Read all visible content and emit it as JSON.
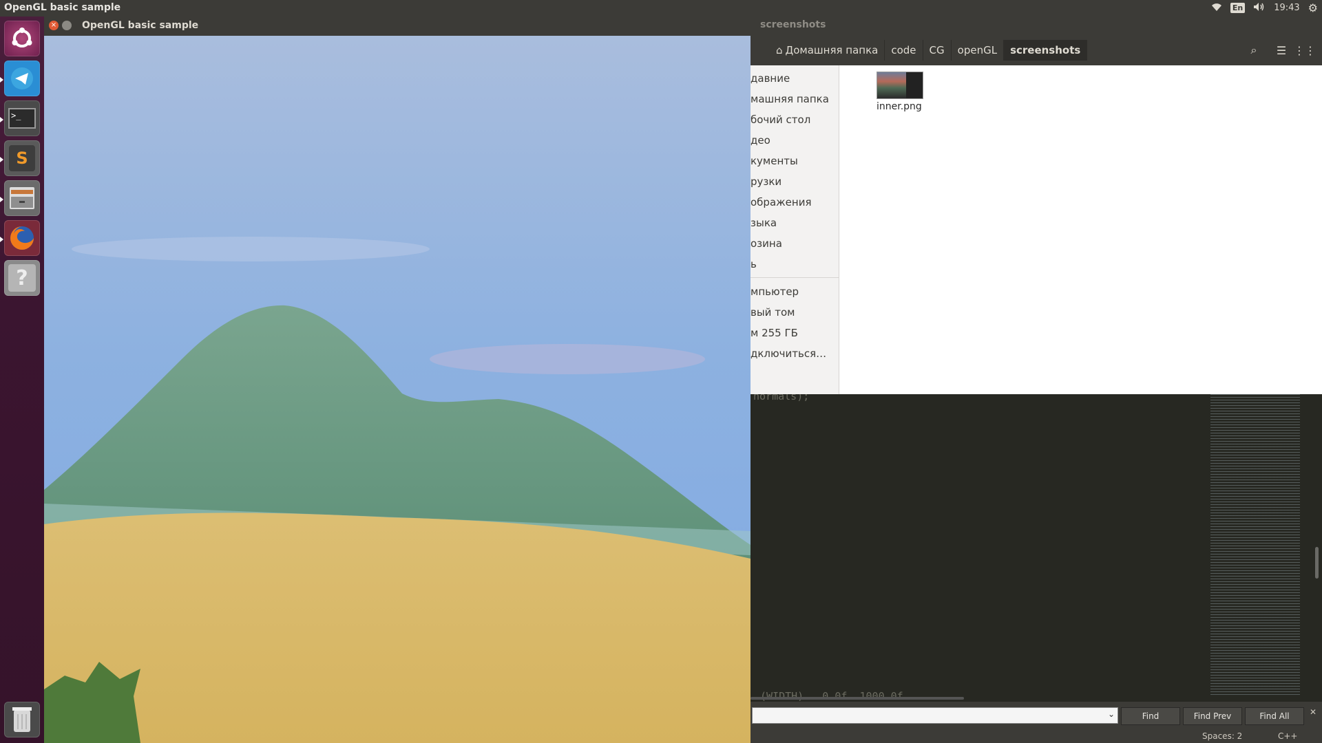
{
  "topbar": {
    "title": "OpenGL basic sample",
    "keyboard": "En",
    "time": "19:43"
  },
  "launcher": {
    "items": [
      "ubuntu-dash-icon",
      "telegram-icon",
      "terminal-icon",
      "sublime-text-icon",
      "files-icon",
      "firefox-icon",
      "help-icon",
      "trash-icon"
    ]
  },
  "gl_window": {
    "title": "OpenGL basic sample"
  },
  "file_manager": {
    "title": "screenshots",
    "breadcrumbs": [
      "Домашняя папка",
      "code",
      "CG",
      "openGL",
      "screenshots"
    ],
    "sidebar": [
      "давние",
      "машняя папка",
      "бочий стол",
      "део",
      "кументы",
      "рузки",
      "ображения",
      "зыка",
      "озина",
      "ь",
      "мпьютер",
      "вый том",
      "м 255 ГБ",
      "дключиться…"
    ],
    "files": [
      {
        "name": "inner.png"
      }
    ]
  },
  "editor": {
    "code_fragment": "normals);",
    "code_fragment_bottom": "(WIDTH)   0.0f  1000.0f"
  },
  "findbar": {
    "find_label": "Find",
    "find_prev_label": "Find Prev",
    "find_all_label": "Find All"
  },
  "statusbar": {
    "spaces": "Spaces: 2",
    "syntax": "C++"
  },
  "colors": {
    "launcher_bg": "#3b1530",
    "titlebar": "#3c3b37",
    "sky": "#8aaedd",
    "sand": "#d8b765",
    "mountain": "#6a9a84",
    "editor_bg": "#272822"
  }
}
